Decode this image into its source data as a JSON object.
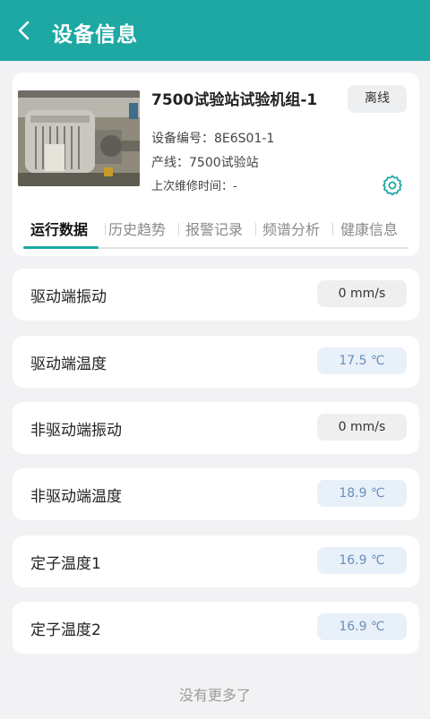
{
  "header": {
    "title": "设备信息"
  },
  "device": {
    "name": "7500试验站试验机组-1",
    "status": "离线",
    "code_text": "设备编号：8E6S01-1",
    "line_text": "产线：7500试验站",
    "maintenance_text": "上次维修时间：-"
  },
  "tabs": [
    "运行数据",
    "历史趋势",
    "报警记录",
    "频谱分析",
    "健康信息"
  ],
  "metrics": [
    {
      "label": "驱动端振动",
      "value": "0 mm/s"
    },
    {
      "label": "驱动端温度",
      "value": "17.5 ℃"
    },
    {
      "label": "非驱动端振动",
      "value": "0 mm/s"
    },
    {
      "label": "非驱动端温度",
      "value": "18.9 ℃"
    },
    {
      "label": "定子温度1",
      "value": "16.9 ℃"
    },
    {
      "label": "定子温度2",
      "value": "16.9 ℃"
    }
  ],
  "footer": {
    "text": "没有更多了"
  },
  "colors": {
    "accent": "#1ea8a4",
    "background": "#f2f2f4",
    "temp_value_bg": "#e8f0fa"
  }
}
